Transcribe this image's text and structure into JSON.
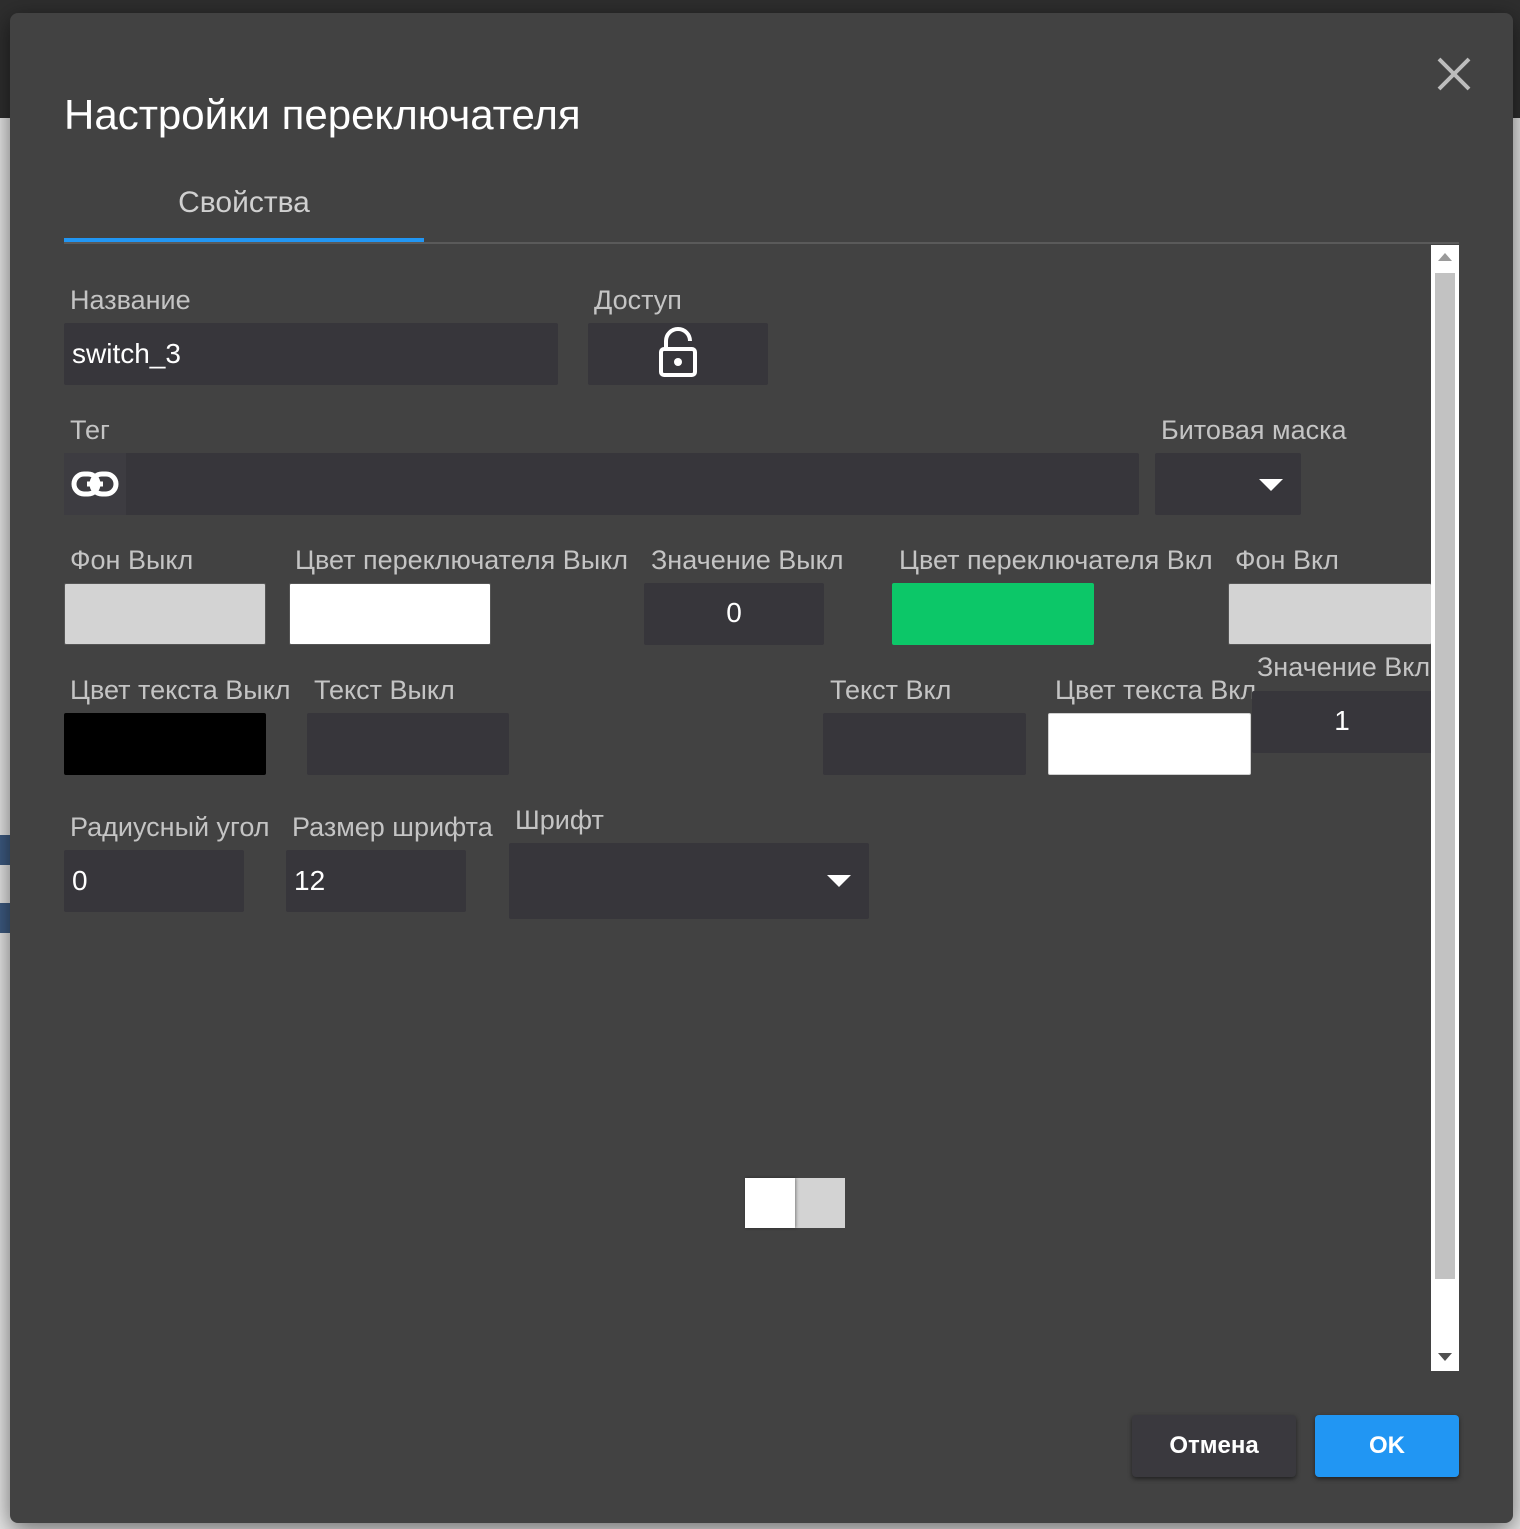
{
  "dialog": {
    "title": "Настройки переключателя",
    "tab": "Свойства"
  },
  "fields": {
    "name_label": "Название",
    "name_value": "switch_3",
    "access_label": "Доступ",
    "tag_label": "Тег",
    "tag_value": "",
    "bitmask_label": "Битовая маска",
    "bg_off_label": "Фон Выкл",
    "switch_color_off_label": "Цвет переключателя Выкл",
    "value_off_label": "Значение Выкл",
    "value_off": "0",
    "switch_color_on_label": "Цвет переключателя Вкл",
    "bg_on_label": "Фон Вкл",
    "value_on_label": "Значение Вкл",
    "value_on": "1",
    "text_color_off_label": "Цвет текста Выкл",
    "text_off_label": "Текст Выкл",
    "text_on_label": "Текст Вкл",
    "text_color_on_label": "Цвет текста Вкл",
    "radius_label": "Радиусный угол",
    "radius_value": "0",
    "font_size_label": "Размер шрифта",
    "font_size_value": "12",
    "font_label": "Шрифт"
  },
  "colors": {
    "bg_off": "#d3d3d3",
    "switch_off": "#ffffff",
    "switch_on": "#0cc768",
    "bg_on": "#d3d3d3",
    "text_off": "#000000",
    "text_on": "#ffffff",
    "accent": "#2196f3"
  },
  "icons": {
    "close": "close-icon",
    "access": "lock-open-icon",
    "tag": "link-icon"
  },
  "buttons": {
    "cancel": "Отмена",
    "ok": "OK"
  }
}
